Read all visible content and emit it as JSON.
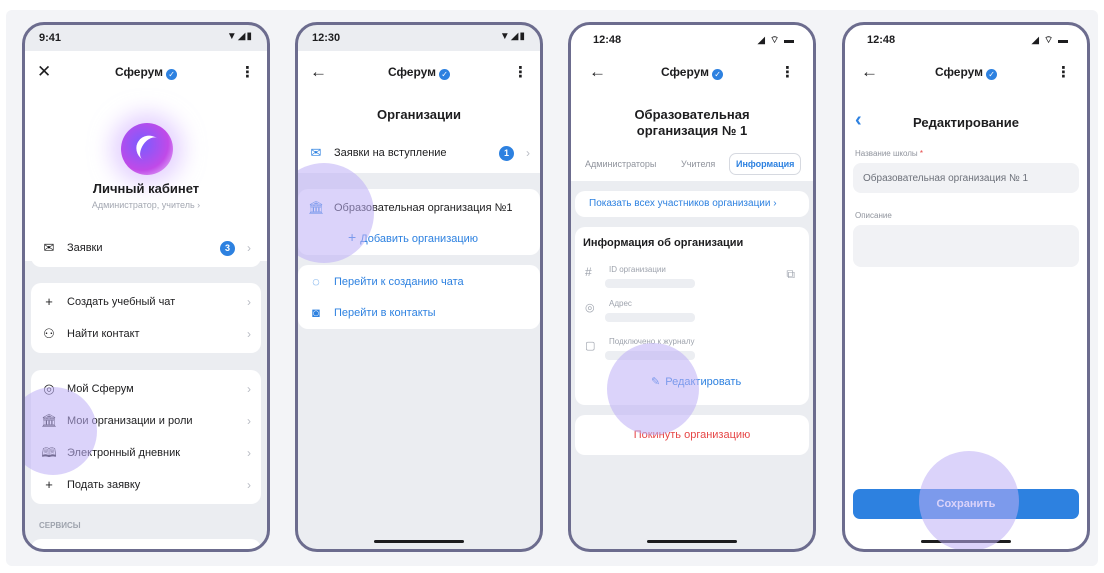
{
  "screen1": {
    "time": "9:41",
    "status_icons": "▼◢▮",
    "app_title": "Сферум",
    "profile_name": "Личный кабинет",
    "profile_role": "Администратор, учитель ›",
    "requests_label": "Заявки",
    "requests_badge": "3",
    "menu_group1": [
      {
        "icon": "+",
        "label": "Создать учебный чат"
      },
      {
        "icon": "⚇",
        "label": "Найти контакт"
      }
    ],
    "menu_group2": [
      {
        "icon": "◎",
        "label": "Мой Сферум"
      },
      {
        "icon": "🏛",
        "label": "Мои организации и роли"
      },
      {
        "icon": "🕮",
        "label": "Электронный дневник"
      },
      {
        "icon": "+",
        "label": "Подать заявку"
      }
    ],
    "services_heading": "СЕРВИСЫ"
  },
  "screen2": {
    "time": "12:30",
    "status_icons": "▼◢▮",
    "app_title": "Сферум",
    "page_title": "Организации",
    "join_requests_label": "Заявки на вступление",
    "join_requests_badge": "1",
    "org_name": "Образовательная организация №1",
    "add_org_label": "Добавить организацию",
    "create_chat_label": "Перейти к созданию чата",
    "contacts_label": "Перейти в контакты"
  },
  "screen3": {
    "time": "12:48",
    "status_icons": "◢ ⌔ ▬",
    "app_title": "Сферум",
    "org_title_line1": "Образовательная",
    "org_title_line2": "организация № 1",
    "tabs": [
      "Администраторы",
      "Учителя",
      "Информация"
    ],
    "active_tab": "Информация",
    "show_members_label": "Показать всех участников организации ›",
    "info_heading": "Информация об организации",
    "field_id_label": "ID организации",
    "field_address_label": "Адрес",
    "field_journal_label": "Подключено к журналу",
    "edit_label": "Редактировать",
    "leave_label": "Покинуть организацию"
  },
  "screen4": {
    "time": "12:48",
    "status_icons": "◢ ⌔ ▬",
    "app_title": "Сферум",
    "page_title": "Редактирование",
    "school_name_label": "Название школы",
    "required_mark": "*",
    "school_name_value": "Образовательная организация № 1",
    "description_label": "Описание",
    "save_label": "Сохранить"
  }
}
